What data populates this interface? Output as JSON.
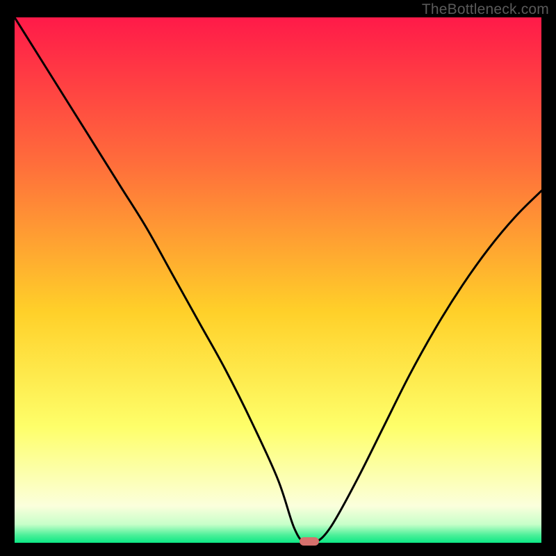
{
  "watermark": "TheBottleneck.com",
  "colors": {
    "gradient_top": "#ff1a49",
    "gradient_mid_upper": "#ff6e3b",
    "gradient_mid": "#ffd029",
    "gradient_mid_lower": "#feff6a",
    "gradient_pale": "#fbffdc",
    "gradient_green": "#0be884",
    "frame_black": "#000000",
    "curve": "#000000",
    "marker": "#d6706d"
  },
  "chart_data": {
    "type": "line",
    "title": "",
    "xlabel": "",
    "ylabel": "",
    "xlim": [
      0,
      100
    ],
    "ylim": [
      0,
      100
    ],
    "series": [
      {
        "name": "bottleneck-curve",
        "x": [
          0,
          5,
          10,
          15,
          20,
          25,
          30,
          35,
          40,
          45,
          50,
          53,
          55,
          57,
          60,
          65,
          70,
          75,
          80,
          85,
          90,
          95,
          100
        ],
        "values": [
          100,
          92,
          84,
          76,
          68,
          60,
          51,
          42,
          33,
          23,
          12,
          3,
          0,
          0,
          3,
          12,
          22,
          32,
          41,
          49,
          56,
          62,
          67
        ]
      }
    ],
    "marker": {
      "x": 56,
      "y": 0
    },
    "gradient_stops": [
      {
        "pos": 0.0,
        "color": "#ff1a49"
      },
      {
        "pos": 0.28,
        "color": "#ff6e3b"
      },
      {
        "pos": 0.56,
        "color": "#ffd029"
      },
      {
        "pos": 0.78,
        "color": "#feff6a"
      },
      {
        "pos": 0.93,
        "color": "#fbffdc"
      },
      {
        "pos": 0.965,
        "color": "#c7ffc9"
      },
      {
        "pos": 0.985,
        "color": "#4ef09a"
      },
      {
        "pos": 1.0,
        "color": "#0be884"
      }
    ]
  }
}
